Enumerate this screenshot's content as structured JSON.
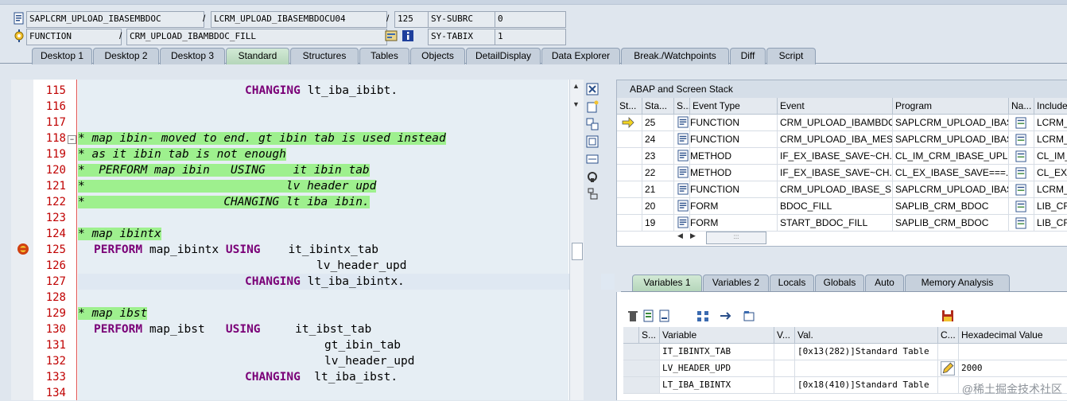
{
  "header": {
    "program": "SAPLCRM_UPLOAD_IBASEMBDOC",
    "include": "LCRM_UPLOAD_IBASEMBDOCU04",
    "line": "125",
    "sysfield1_name": "SY-SUBRC",
    "sysfield1_value": "0",
    "event_type": "FUNCTION",
    "event": "CRM_UPLOAD_IBAMBDOC_FILL",
    "sysfield2_name": "SY-TABIX",
    "sysfield2_value": "1",
    "slash": "/"
  },
  "tabs": [
    {
      "label": "Desktop 1"
    },
    {
      "label": "Desktop 2"
    },
    {
      "label": "Desktop 3"
    },
    {
      "label": "Standard"
    },
    {
      "label": "Structures"
    },
    {
      "label": "Tables"
    },
    {
      "label": "Objects"
    },
    {
      "label": "DetailDisplay"
    },
    {
      "label": "Data Explorer"
    },
    {
      "label": "Break./Watchpoints"
    },
    {
      "label": "Diff"
    },
    {
      "label": "Script"
    }
  ],
  "active_tab": "Standard",
  "code": {
    "lines": [
      {
        "num": "115",
        "text": "CHANGING lt_iba_ibibt."
      },
      {
        "num": "116",
        "text": ""
      },
      {
        "num": "117",
        "text": ""
      },
      {
        "num": "118",
        "text": "* map ibin- moved to end. gt ibin tab is used instead"
      },
      {
        "num": "119",
        "text": "* as it ibin tab is not enough"
      },
      {
        "num": "120",
        "text": "*  PERFORM map ibin   USING    it ibin tab"
      },
      {
        "num": "121",
        "text": "*                             lv header upd"
      },
      {
        "num": "122",
        "text": "*                    CHANGING lt iba ibin."
      },
      {
        "num": "123",
        "text": ""
      },
      {
        "num": "124",
        "text": "* map ibintx"
      },
      {
        "num": "125",
        "text": "PERFORM map_ibintx USING    it_ibintx_tab"
      },
      {
        "num": "126",
        "text": "lv_header_upd"
      },
      {
        "num": "127",
        "text": "CHANGING lt_iba_ibintx."
      },
      {
        "num": "128",
        "text": ""
      },
      {
        "num": "129",
        "text": "* map ibst"
      },
      {
        "num": "130",
        "text": "PERFORM map_ibst   USING     it_ibst_tab"
      },
      {
        "num": "131",
        "text": "gt_ibin_tab"
      },
      {
        "num": "132",
        "text": "lv_header_upd"
      },
      {
        "num": "133",
        "text": "CHANGING  lt_iba_ibst."
      },
      {
        "num": "134",
        "text": ""
      }
    ]
  },
  "stack": {
    "title": "ABAP and Screen Stack",
    "columns": [
      "St...",
      "Sta...",
      "S...",
      "Event Type",
      "Event",
      "Program",
      "Na...",
      "Include"
    ],
    "rows": [
      {
        "sta": "25",
        "type": "FUNCTION",
        "event": "CRM_UPLOAD_IBAMBDO...",
        "program": "SAPLCRM_UPLOAD_IBAS...",
        "include": "LCRM_U",
        "current": true
      },
      {
        "sta": "24",
        "type": "FUNCTION",
        "event": "CRM_UPLOAD_IBA_MES...",
        "program": "SAPLCRM_UPLOAD_IBAS...",
        "include": "LCRM_U",
        "current": false
      },
      {
        "sta": "23",
        "type": "METHOD",
        "event": "IF_EX_IBASE_SAVE~CH...",
        "program": "CL_IM_CRM_IBASE_UPL...",
        "include": "CL_IM_C",
        "current": false
      },
      {
        "sta": "22",
        "type": "METHOD",
        "event": "IF_EX_IBASE_SAVE~CH...",
        "program": "CL_EX_IBASE_SAVE===...",
        "include": "CL_EX_",
        "current": false
      },
      {
        "sta": "21",
        "type": "FUNCTION",
        "event": "CRM_UPLOAD_IBASE_SI...",
        "program": "SAPLCRM_UPLOAD_IBAS...",
        "include": "LCRM_U",
        "current": false
      },
      {
        "sta": "20",
        "type": "FORM",
        "event": "BDOC_FILL",
        "program": "SAPLIB_CRM_BDOC",
        "include": "LIB_CRM",
        "current": false
      },
      {
        "sta": "19",
        "type": "FORM",
        "event": "START_BDOC_FILL",
        "program": "SAPLIB_CRM_BDOC",
        "include": "LIB_CRM",
        "current": false
      }
    ],
    "hscroll_thumb": ":::"
  },
  "var_tabs": [
    {
      "label": "Variables 1"
    },
    {
      "label": "Variables 2"
    },
    {
      "label": "Locals"
    },
    {
      "label": "Globals"
    },
    {
      "label": "Auto"
    },
    {
      "label": "Memory Analysis"
    }
  ],
  "variables": {
    "columns": [
      "S...",
      "Variable",
      "V...",
      "Val.",
      "C...",
      "Hexadecimal Value"
    ],
    "rows": [
      {
        "name": "IT_IBINTX_TAB",
        "value": "[0x13(282)]Standard Table",
        "hex": ""
      },
      {
        "name": "LV_HEADER_UPD",
        "value": "",
        "hex": "2000"
      },
      {
        "name": "LT_IBA_IBINTX",
        "value": "[0x18(410)]Standard Table",
        "hex": ""
      }
    ]
  },
  "watermark": "@稀土掘金技术社区",
  "colors": {
    "keyword": "#7a0077",
    "comment_bg": "#9ef08e",
    "line_number": "#c00000",
    "active_tab": "#c2dcc6"
  }
}
